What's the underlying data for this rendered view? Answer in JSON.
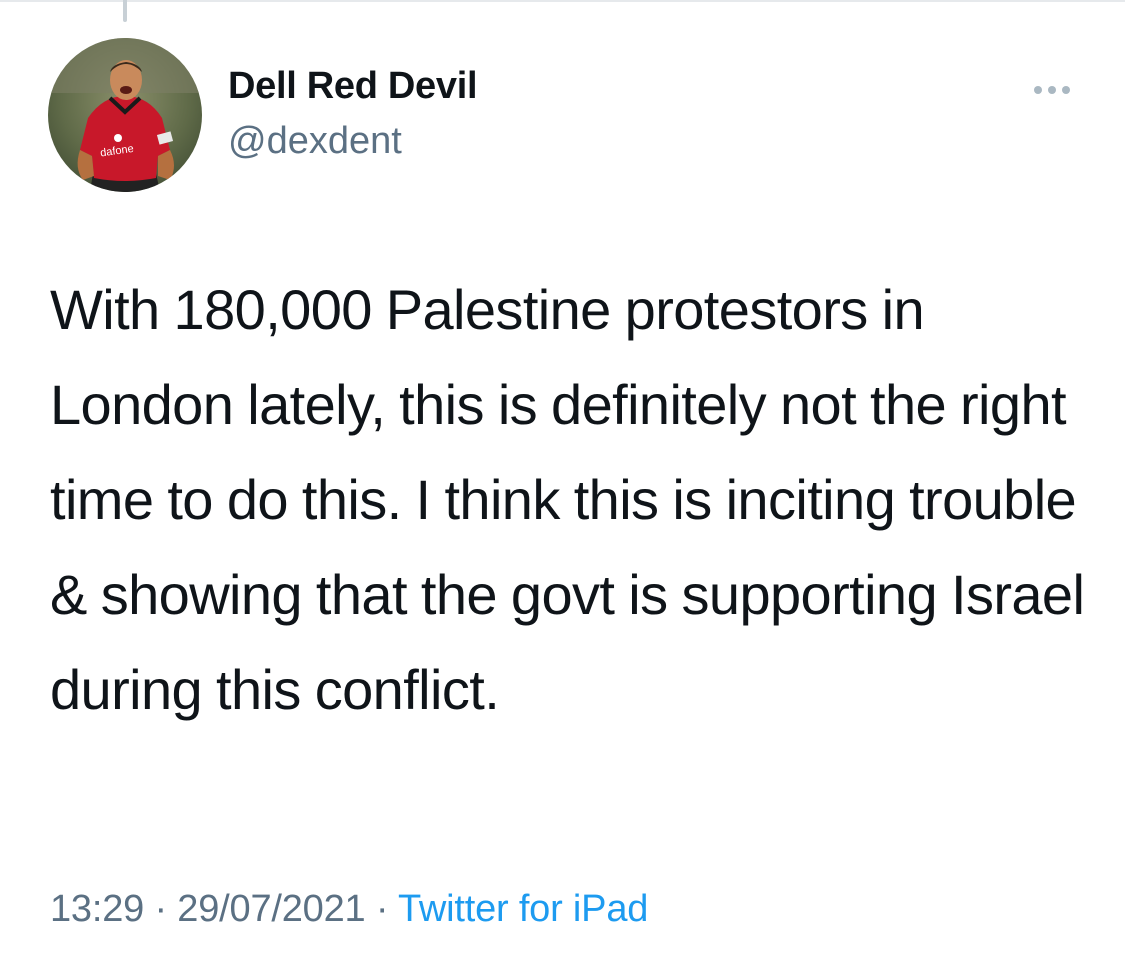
{
  "tweet": {
    "author": {
      "display_name": "Dell Red Devil",
      "handle": "@dexdent",
      "avatar_icon": "profile-photo-footballer-red-kit"
    },
    "more_icon": "more-options-icon",
    "text": "With 180,000 Palestine protestors in London lately, this is definitely not the right time to do this. I think this is inciting trouble & showing that the govt is supporting Israel during this conflict.",
    "time": "13:29",
    "separator": "·",
    "date": "29/07/2021",
    "source": "Twitter for iPad"
  },
  "colors": {
    "text_primary": "#0f1419",
    "text_secondary": "#5b7083",
    "link": "#1d9bf0",
    "divider": "#e6e9ec"
  }
}
